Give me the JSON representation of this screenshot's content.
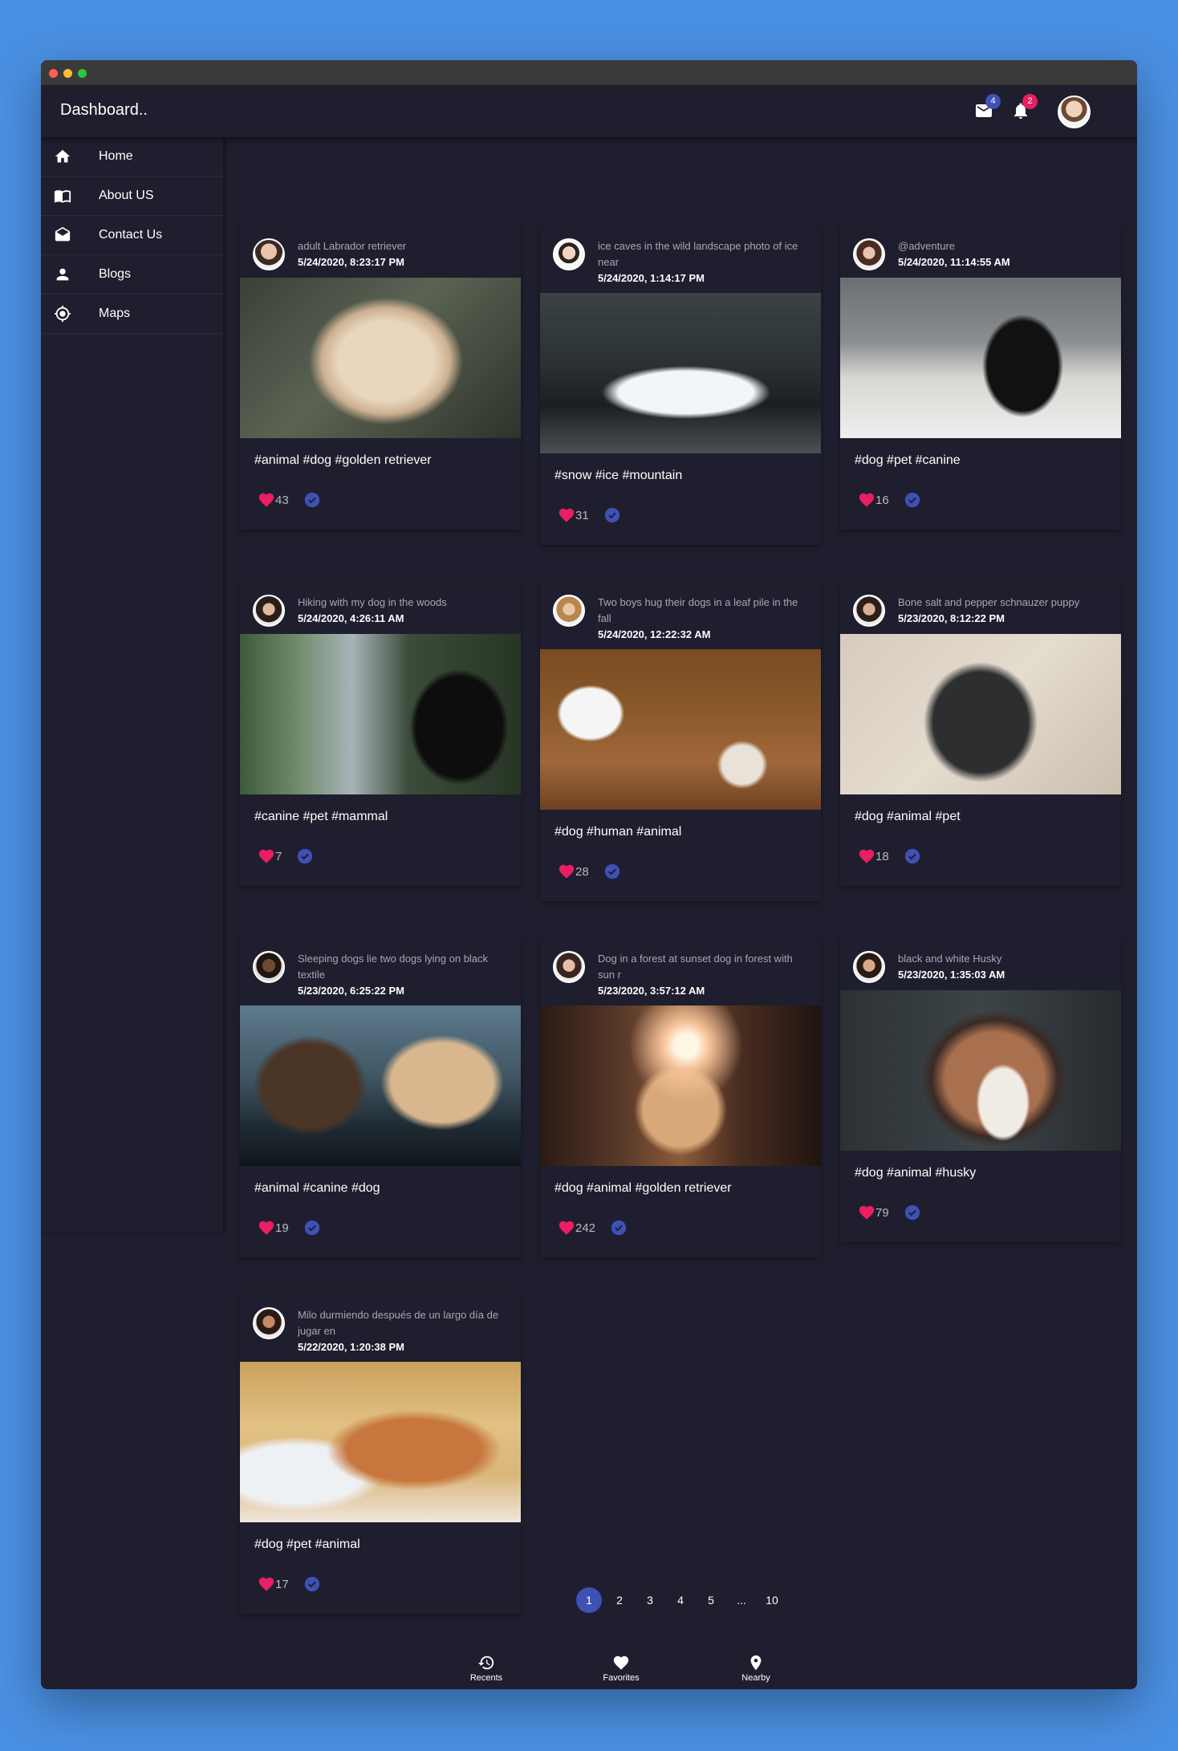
{
  "app": {
    "title": "Dashboard.."
  },
  "header": {
    "mail_badge": "4",
    "notifications_badge": "2",
    "colors": {
      "badge_blue": "#3f51b5",
      "badge_pink": "#e91e63"
    }
  },
  "sidebar": {
    "items": [
      {
        "label": "Home",
        "icon": "home-icon"
      },
      {
        "label": "About US",
        "icon": "book-icon"
      },
      {
        "label": "Contact Us",
        "icon": "mail-open-icon"
      },
      {
        "label": "Blogs",
        "icon": "person-icon"
      },
      {
        "label": "Maps",
        "icon": "location-target-icon"
      }
    ]
  },
  "cards": [
    {
      "subtitle": "adult Labrador retriever",
      "date": "5/24/2020, 8:23:17 PM",
      "tags": "#animal #dog #golden retriever",
      "likes": "43"
    },
    {
      "subtitle": "ice caves in the wild landscape photo of ice near",
      "date": "5/24/2020, 1:14:17 PM",
      "tags": "#snow #ice #mountain",
      "likes": "31"
    },
    {
      "subtitle": "@adventure",
      "date": "5/24/2020, 11:14:55 AM",
      "tags": "#dog #pet #canine",
      "likes": "16"
    },
    {
      "subtitle": "Hiking with my dog in the woods",
      "date": "5/24/2020, 4:26:11 AM",
      "tags": "#canine #pet #mammal",
      "likes": "7"
    },
    {
      "subtitle": "Two boys hug their dogs in a leaf pile in the fall",
      "date": "5/24/2020, 12:22:32 AM",
      "tags": "#dog #human #animal",
      "likes": "28"
    },
    {
      "subtitle": "Bone salt and pepper schnauzer puppy",
      "date": "5/23/2020, 8:12:22 PM",
      "tags": "#dog #animal #pet",
      "likes": "18"
    },
    {
      "subtitle": "Sleeping dogs lie two dogs lying on black textile",
      "date": "5/23/2020, 6:25:22 PM",
      "tags": "#animal #canine #dog",
      "likes": "19"
    },
    {
      "subtitle": "Dog in a forest at sunset dog in forest with sun r",
      "date": "5/23/2020, 3:57:12 AM",
      "tags": "#dog #animal #golden retriever",
      "likes": "242"
    },
    {
      "subtitle": "black and white Husky",
      "date": "5/23/2020, 1:35:03 AM",
      "tags": "#dog #animal #husky",
      "likes": "79"
    },
    {
      "subtitle": "Milo durmiendo después de un largo día de jugar en",
      "date": "5/22/2020, 1:20:38 PM",
      "tags": "#dog #pet #animal",
      "likes": "17"
    }
  ],
  "pagination": {
    "pages": [
      "1",
      "2",
      "3",
      "4",
      "5",
      "...",
      "10"
    ],
    "current": "1"
  },
  "bottom_nav": {
    "recents": "Recents",
    "favorites": "Favorites",
    "nearby": "Nearby"
  }
}
